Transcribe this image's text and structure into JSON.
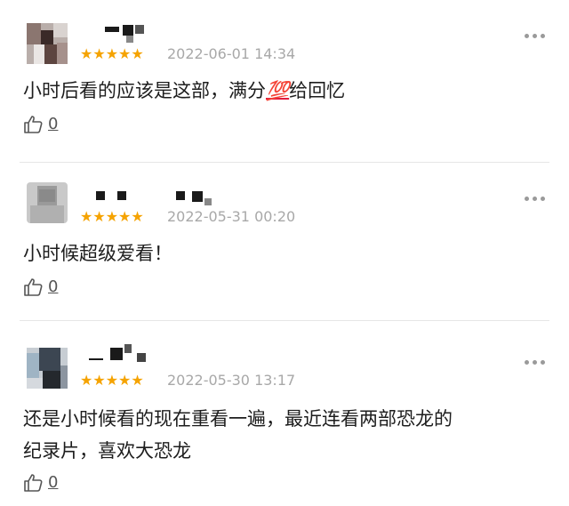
{
  "reviews": [
    {
      "time": "2022-06-01 14:34",
      "content_before": "小时后看的应该是这部，满分",
      "content_emoji": "💯",
      "content_after": "给回忆",
      "likes": "0",
      "rating": 5,
      "stars": "★★★★★"
    },
    {
      "time": "2022-05-31 00:20",
      "content": "小时候超级爱看！",
      "likes": "0",
      "rating": 5,
      "stars": "★★★★★"
    },
    {
      "time": "2022-05-30 13:17",
      "content_line1": "还是小时候看的现在重看一遍，最近连看两部恐龙的",
      "content_line2": "纪录片，喜欢大恐龙",
      "likes": "0",
      "rating": 5,
      "stars": "★★★★★"
    }
  ],
  "icons": {
    "like": "thumbs-up-icon",
    "more": "more-dots-icon"
  },
  "colors": {
    "star": "#f5a300",
    "time": "#a8a8a8",
    "divider": "#e6e6e6"
  }
}
